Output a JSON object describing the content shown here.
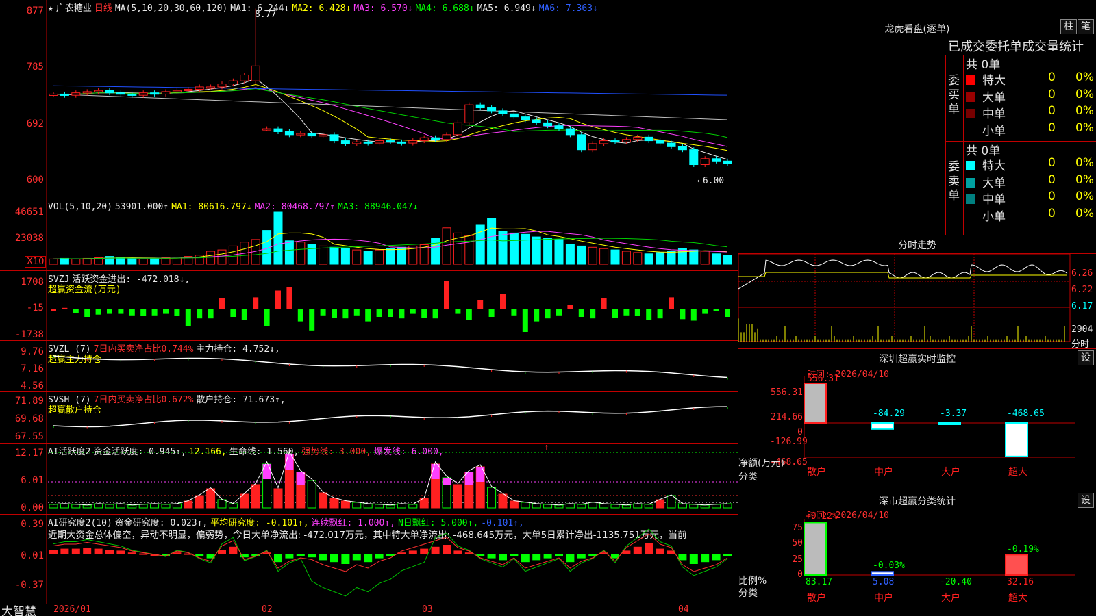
{
  "stock": {
    "star": "★",
    "name": "广农糖业",
    "period": "日线"
  },
  "main_hdr": {
    "ma": "MA(5,10,20,30,60,120)",
    "ma1": "MA1: 6.244↓",
    "ma2": "MA2: 6.428↓",
    "ma3": "MA3: 6.570↓",
    "ma4": "MA4: 6.688↓",
    "ma5": "MA5: 6.949↓",
    "ma6": "MA6: 7.363↓"
  },
  "main_y": [
    "877",
    "785",
    "692",
    "600"
  ],
  "main_ann": {
    "high": "8.77",
    "low": "←6.00"
  },
  "vol_hdr": {
    "name": "VOL(5,10,20)",
    "val": "53901.000↑",
    "ma1": "MA1: 80616.797↓",
    "ma2": "MA2: 80468.797↑",
    "ma3": "MA3: 88946.047↓"
  },
  "vol_y": [
    "46651",
    "23038"
  ],
  "vol_unit": "X10",
  "svzj_hdr": {
    "name": "SVZJ",
    "desc": "活跃资金进出: -472.018↓,",
    "sub": "超赢资金流(万元)"
  },
  "svzj_y": [
    "1708",
    "-15",
    "-1738"
  ],
  "svzl_hdr": {
    "name": "SVZL (7)",
    "desc": "7日内买卖净占比0.744%",
    "hold": "主力持仓: 4.752↓,",
    "sub": "超赢主力持仓"
  },
  "svzl_y": [
    "9.76",
    "7.16",
    "4.56"
  ],
  "svsh_hdr": {
    "name": "SVSH (7)",
    "desc": "7日内买卖净占比0.672%",
    "hold": "散户持仓: 71.673↑,",
    "sub": "超赢散户持仓"
  },
  "svsh_y": [
    "71.89",
    "69.68",
    "67.55"
  ],
  "ai_hdr": {
    "name": "AI活跃度2",
    "v1": "资金活跃度: 0.945↑,",
    "v2": "12.166,",
    "v3": "生命线: 1.560,",
    "v4": "强势线: 3.000,",
    "v5": "爆发线: 6.000,",
    "arrow": "↑"
  },
  "ai_y": [
    "12.17",
    "6.01",
    "0.00"
  ],
  "air_hdr": {
    "name": "AI研究度2(10)",
    "v1": "资金研究度: 0.023↑,",
    "v2": "平均研究度: -0.101↑,",
    "v3": "连续飘红: 1.000↑,",
    "v4": "N日飘红: 5.000↑,",
    "v5": "-0.101↑,"
  },
  "air_text": "近期大资金总体偏空，异动不明显，偏弱势，今日大单净流出: -472.017万元，其中特大单净流出: -468.645万元，大单5日累计净出-1135.751万元，当前",
  "air_y": [
    "0.39",
    "0.01",
    "-0.37"
  ],
  "xaxis": {
    "brand": "大智慧",
    "d1": "2026/01",
    "d2": "02",
    "d3": "03",
    "d4": "04"
  },
  "lhb": {
    "title": "龙虎看盘(逐单)",
    "btn1": "柱",
    "btn2": "笔",
    "header": "已成交委托单成交量统计",
    "buy_label": "委买单",
    "buy_total": "共 0单",
    "sell_label": "委卖单",
    "sell_total": "共 0单",
    "buy_rows": [
      {
        "label": "特大",
        "n": "0",
        "p": "0%",
        "color": "#ff0000"
      },
      {
        "label": "大单",
        "n": "0",
        "p": "0%",
        "color": "#990000"
      },
      {
        "label": "中单",
        "n": "0",
        "p": "0%",
        "color": "#770000"
      },
      {
        "label": "小单",
        "n": "0",
        "p": "0%",
        "color": "#000000"
      }
    ],
    "sell_rows": [
      {
        "label": "特大",
        "n": "0",
        "p": "0%",
        "color": "#00ffff"
      },
      {
        "label": "大单",
        "n": "0",
        "p": "0%",
        "color": "#00a0a0"
      },
      {
        "label": "中单",
        "n": "0",
        "p": "0%",
        "color": "#008080"
      },
      {
        "label": "小单",
        "n": "0",
        "p": "0%",
        "color": "#000000"
      }
    ]
  },
  "fs": {
    "title": "分时走势",
    "y": [
      "6.26",
      "6.22",
      "6.17"
    ],
    "vol": "2904",
    "vol_lbl": "分时"
  },
  "szm": {
    "title": "深圳超赢实时监控",
    "btn": "设",
    "time": "时间: 2026/04/10",
    "y": [
      "556.31",
      "214.66",
      "0",
      "-126.99",
      "-468.65"
    ],
    "vals": [
      "556.31",
      "-84.29",
      "-3.37",
      "-468.65"
    ],
    "ylab": "净额(万元)",
    "xlab": "分类",
    "cats": [
      "散户",
      "中户",
      "大户",
      "超大"
    ]
  },
  "scl": {
    "title": "深市超赢分类统计",
    "btn": "设",
    "time": "时间: 2026/04/10",
    "y": [
      "75",
      "50",
      "25",
      "0"
    ],
    "tops": [
      "+0.22%",
      "-0.03%",
      "-0.19%"
    ],
    "vals": [
      "83.17",
      "5.08",
      "-20.40",
      "32.16"
    ],
    "ylab": "比例%",
    "xlab": "分类",
    "cats": [
      "散户",
      "中户",
      "大户",
      "超大"
    ]
  },
  "colors": {
    "up": "#ff2020",
    "down": "#00ffff",
    "grid": "#c00000"
  },
  "chart_data": {
    "type": "candlestick",
    "x_ticks": [
      "2026/01",
      "02",
      "03",
      "04"
    ],
    "close": [
      7.38,
      7.36,
      7.4,
      7.42,
      7.44,
      7.4,
      7.38,
      7.36,
      7.4,
      7.38,
      7.42,
      7.44,
      7.46,
      7.5,
      7.5,
      7.55,
      7.6,
      7.7,
      7.85,
      6.8,
      6.75,
      6.7,
      6.72,
      6.68,
      6.7,
      6.6,
      6.55,
      6.58,
      6.56,
      6.6,
      6.58,
      6.56,
      6.6,
      6.65,
      6.62,
      6.7,
      6.9,
      7.2,
      7.15,
      7.1,
      7.05,
      7.0,
      6.95,
      6.9,
      6.85,
      6.8,
      6.7,
      6.45,
      6.55,
      6.6,
      6.58,
      6.62,
      6.66,
      6.6,
      6.56,
      6.5,
      6.45,
      6.2,
      6.3,
      6.26,
      6.22
    ],
    "high": 8.77,
    "low": 6.0
  }
}
